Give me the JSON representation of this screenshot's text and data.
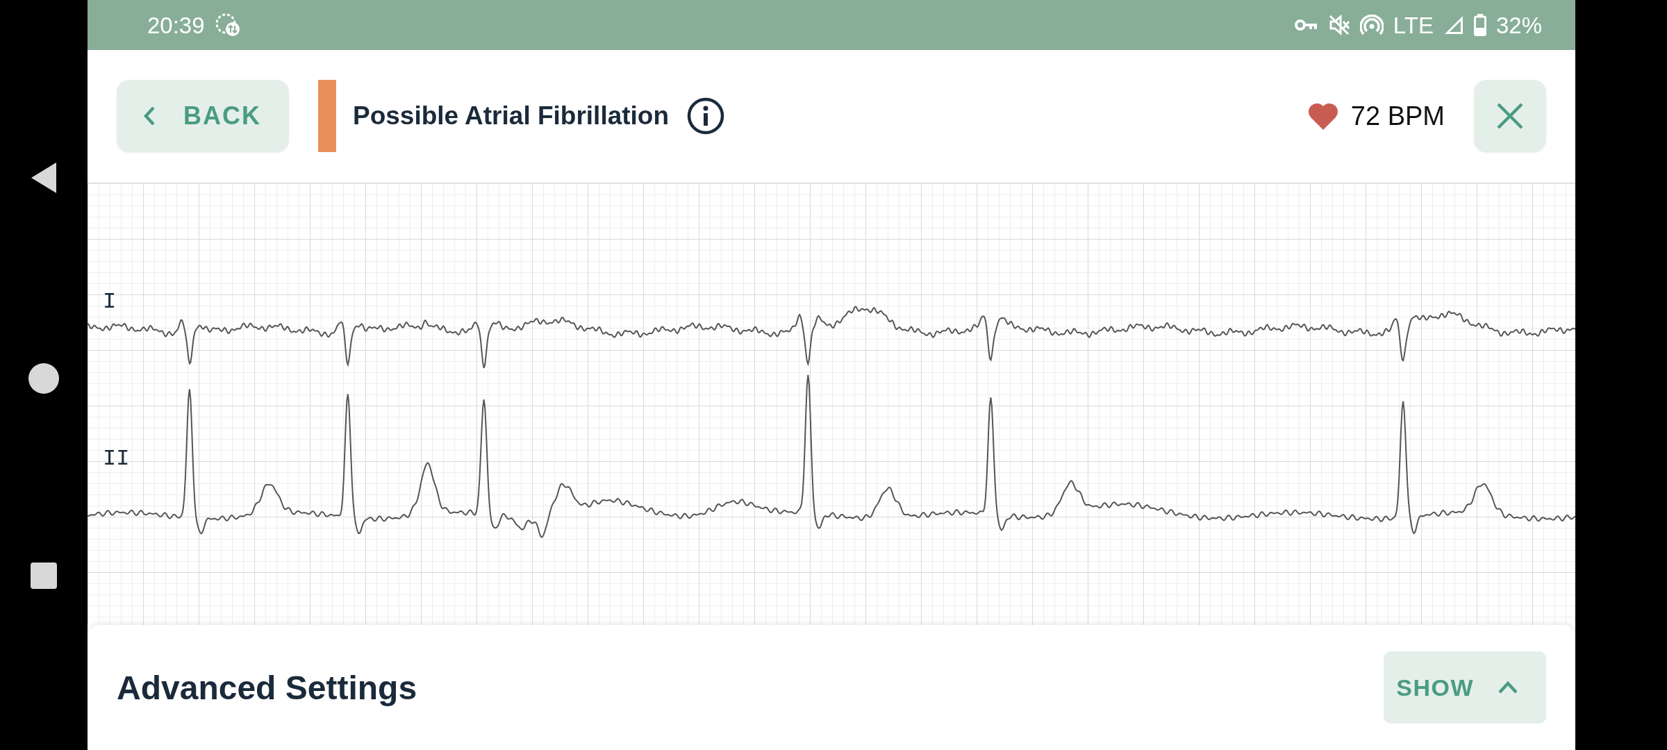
{
  "status_bar": {
    "time": "20:39",
    "network": "LTE",
    "battery": "32%"
  },
  "header": {
    "back_button": "BACK",
    "title": "Possible Atrial Fibrillation",
    "heart_rate": "72 BPM"
  },
  "ecg": {
    "leads": [
      {
        "label": "I"
      },
      {
        "label": "II"
      }
    ]
  },
  "advanced_settings": {
    "title": "Advanced Settings",
    "toggle": "SHOW",
    "expanded": false
  }
}
